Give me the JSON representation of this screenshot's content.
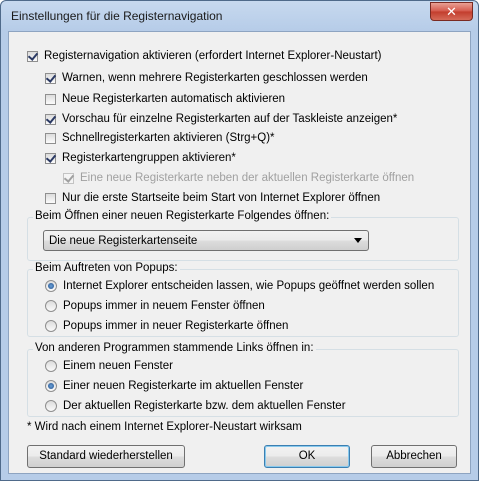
{
  "window": {
    "title": "Einstellungen für die Registernavigation",
    "close_glyph": "✕"
  },
  "checkboxes": [
    {
      "label": "Registernavigation aktivieren (erfordert Internet Explorer-Neustart)",
      "checked": true,
      "enabled": true
    },
    {
      "label": "Warnen, wenn mehrere Registerkarten geschlossen werden",
      "checked": true,
      "enabled": true
    },
    {
      "label": "Neue Registerkarten automatisch aktivieren",
      "checked": false,
      "enabled": true
    },
    {
      "label": "Vorschau für einzelne Registerkarten auf der Taskleiste anzeigen*",
      "checked": true,
      "enabled": true
    },
    {
      "label": "Schnellregisterkarten aktivieren (Strg+Q)*",
      "checked": false,
      "enabled": true
    },
    {
      "label": "Registerkartengruppen aktivieren*",
      "checked": true,
      "enabled": true
    },
    {
      "label": "Eine neue Registerkarte neben der aktuellen Registerkarte öffnen",
      "checked": true,
      "enabled": false
    },
    {
      "label": "Nur die erste Startseite beim Start von Internet Explorer öffnen",
      "checked": false,
      "enabled": true
    }
  ],
  "new_tab_group": {
    "legend": "Beim Öffnen einer neuen Registerkarte Folgendes öffnen:",
    "selected": "Die neue Registerkartenseite"
  },
  "popup_group": {
    "legend": "Beim Auftreten von Popups:",
    "options": [
      {
        "label": "Internet Explorer entscheiden lassen, wie Popups geöffnet werden sollen",
        "selected": true
      },
      {
        "label": "Popups immer in neuem Fenster öffnen",
        "selected": false
      },
      {
        "label": "Popups immer in neuer Registerkarte öffnen",
        "selected": false
      }
    ]
  },
  "links_group": {
    "legend": "Von anderen Programmen stammende Links öffnen in:",
    "options": [
      {
        "label": "Einem neuen Fenster",
        "selected": false
      },
      {
        "label": "Einer neuen Registerkarte im aktuellen Fenster",
        "selected": true
      },
      {
        "label": "Der aktuellen Registerkarte bzw. dem aktuellen Fenster",
        "selected": false
      }
    ]
  },
  "footnote": "* Wird nach einem Internet Explorer-Neustart wirksam",
  "buttons": {
    "restore": "Standard wiederherstellen",
    "ok": "OK",
    "cancel": "Abbrechen"
  }
}
